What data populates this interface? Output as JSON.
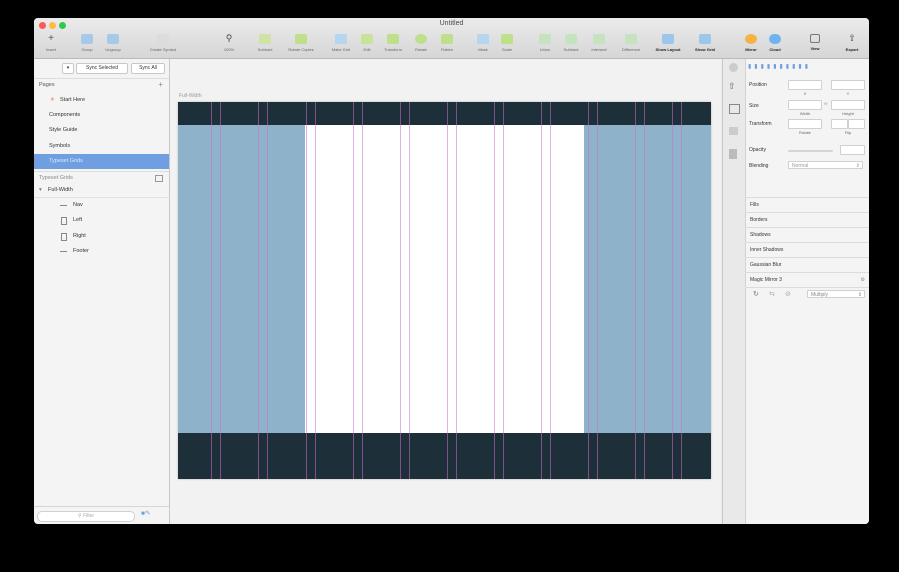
{
  "window": {
    "title": "Untitled"
  },
  "toolbar": {
    "left": [
      {
        "label": "Insert"
      },
      {
        "label": "Group"
      },
      {
        "label": "Ungroup"
      },
      {
        "label": "Create Symbol"
      }
    ],
    "zoom": {
      "label": "100%"
    },
    "center": [
      {
        "label": "Subtract"
      },
      {
        "label": "Rotate Copies"
      },
      {
        "label": "Make Grid"
      },
      {
        "label": "Edit"
      },
      {
        "label": "Transform"
      },
      {
        "label": "Rotate"
      },
      {
        "label": "Flatten"
      },
      {
        "label": "Mask"
      },
      {
        "label": "Scale"
      },
      {
        "label": "Union"
      },
      {
        "label": "Subtract"
      },
      {
        "label": "Intersect"
      },
      {
        "label": "Difference"
      },
      {
        "label": "Show Layout"
      },
      {
        "label": "Show Grid"
      }
    ],
    "right": [
      {
        "label": "Mirror"
      },
      {
        "label": "Cloud"
      },
      {
        "label": "View"
      },
      {
        "label": "Export"
      }
    ]
  },
  "sidebar": {
    "sync_selected": "Sync Selected",
    "sync_all": "Sync All",
    "pages_header": "Pages",
    "add_symbol": "+",
    "pages": [
      {
        "label": "Start Here",
        "selected": false
      },
      {
        "label": "Components",
        "selected": false
      },
      {
        "label": "Style Guide",
        "selected": false
      },
      {
        "label": "Symbols",
        "selected": false
      },
      {
        "label": "Typeset Grids",
        "selected": true
      }
    ],
    "layers_header": "Typeset Grids",
    "layers": [
      {
        "label": "Full-Width",
        "indent": 0
      },
      {
        "label": "Nav",
        "indent": 1
      },
      {
        "label": "Left",
        "indent": 1
      },
      {
        "label": "Right",
        "indent": 1
      },
      {
        "label": "Footer",
        "indent": 1
      }
    ],
    "filter_placeholder": "Filter"
  },
  "canvas": {
    "artboard_label": "Full-Width",
    "colors": {
      "dark": "#1d2f38",
      "column": "#8fb2cb",
      "guide": "#cd6ecd"
    }
  },
  "inspector": {
    "position_label": "Position",
    "x_label": "X",
    "y_label": "Y",
    "size_label": "Size",
    "width_label": "Width",
    "height_label": "Height",
    "transform_label": "Transform",
    "rotate_label": "Rotate",
    "flip_label": "Flip",
    "opacity_label": "Opacity",
    "blending_label": "Blending",
    "blending_value": "Normal",
    "sections": [
      "Fills",
      "Borders",
      "Shadows",
      "Inner Shadows",
      "Gaussian Blur",
      "Magic Mirror 3"
    ],
    "mirror_value": "Multiply"
  }
}
